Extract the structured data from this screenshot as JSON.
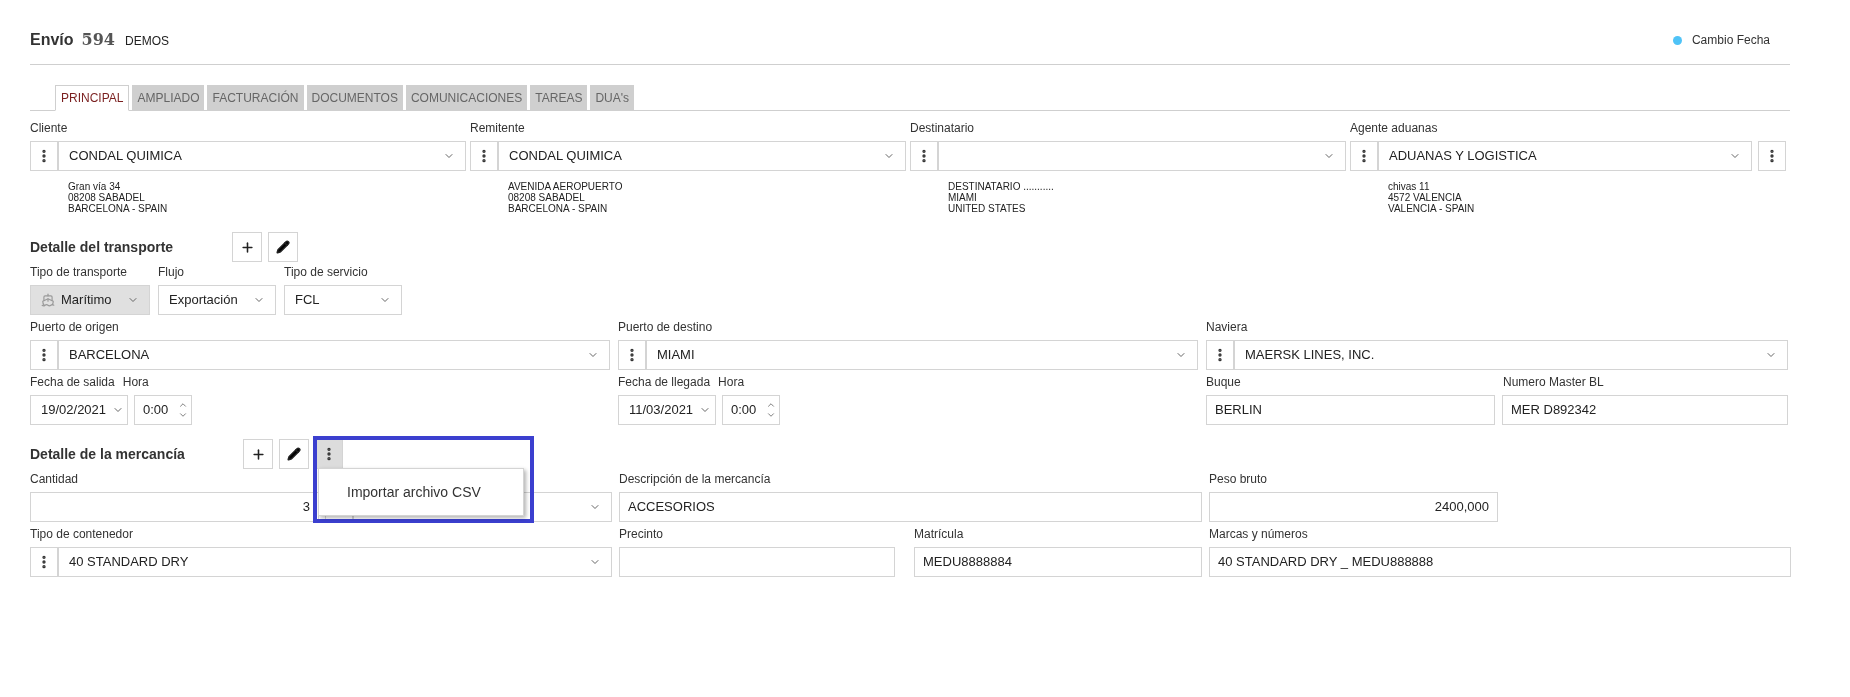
{
  "header": {
    "title": "Envío",
    "number": "594",
    "subtitle": "DEMOS",
    "legend": {
      "label": "Cambio Fecha",
      "color": "#4fc3f7"
    }
  },
  "tabs": [
    {
      "label": "PRINCIPAL",
      "selected": true
    },
    {
      "label": "AMPLIADO",
      "selected": false
    },
    {
      "label": "FACTURACIÓN",
      "selected": false
    },
    {
      "label": "DOCUMENTOS",
      "selected": false
    },
    {
      "label": "COMUNICACIONES",
      "selected": false
    },
    {
      "label": "TAREAS",
      "selected": false
    },
    {
      "label": "DUA's",
      "selected": false
    }
  ],
  "parties": [
    {
      "label": "Cliente",
      "value": "CONDAL QUIMICA",
      "address": [
        "Gran vía 34",
        "08208 SABADEL",
        "BARCELONA - SPAIN"
      ]
    },
    {
      "label": "Remitente",
      "value": "CONDAL QUIMICA",
      "address": [
        "AVENIDA AEROPUERTO",
        "08208 SABADEL",
        "BARCELONA - SPAIN"
      ]
    },
    {
      "label": "Destinatario",
      "address": [
        "DESTINATARIO ...........",
        "MIAMI",
        "UNITED STATES"
      ]
    },
    {
      "label": "Agente aduanas",
      "value": "ADUANAS Y LOGISTICA",
      "address": [
        "chivas 11",
        "4572 VALENCIA",
        "VALENCIA - SPAIN"
      ]
    }
  ],
  "transport": {
    "title": "Detalle del transporte",
    "selects": [
      {
        "label": "Tipo de transporte",
        "value": "Marítimo",
        "disabled": true
      },
      {
        "label": "Flujo",
        "value": "Exportación",
        "disabled": false
      },
      {
        "label": "Tipo de servicio",
        "value": "FCL",
        "disabled": false
      }
    ],
    "ports": [
      {
        "label": "Puerto de origen",
        "value": "BARCELONA"
      },
      {
        "label": "Puerto de destino",
        "value": "MIAMI"
      },
      {
        "label": "Naviera",
        "value": "MAERSK LINES, INC."
      }
    ],
    "dates": [
      {
        "date_label": "Fecha de salida",
        "date": "19/02/2021",
        "time_label": "Hora",
        "time": "0:00"
      },
      {
        "date_label": "Fecha de llegada",
        "date": "11/03/2021",
        "time_label": "Hora",
        "time": "0:00"
      }
    ],
    "vessel": {
      "label": "Buque",
      "value": "BERLIN"
    },
    "master_bl": {
      "label": "Numero Master BL",
      "value": "MER D892342"
    }
  },
  "goods": {
    "title": "Detalle de la mercancía",
    "menu": {
      "open": true,
      "items": [
        "Importar archivo CSV"
      ]
    },
    "quantity": {
      "label": "Cantidad",
      "value": "3"
    },
    "description": {
      "label": "Descripción de la mercancía",
      "value": "ACCESORIOS"
    },
    "gross_weight": {
      "label": "Peso bruto",
      "value": "2400,000"
    },
    "container_type": {
      "label": "Tipo de contenedor",
      "value": "40 STANDARD DRY"
    },
    "seal": {
      "label": "Precinto"
    },
    "plate": {
      "label": "Matrícula",
      "value": "MEDU8888884"
    },
    "marks": {
      "label": "Marcas y números",
      "value": "40 STANDARD DRY _ MEDU888888"
    }
  }
}
